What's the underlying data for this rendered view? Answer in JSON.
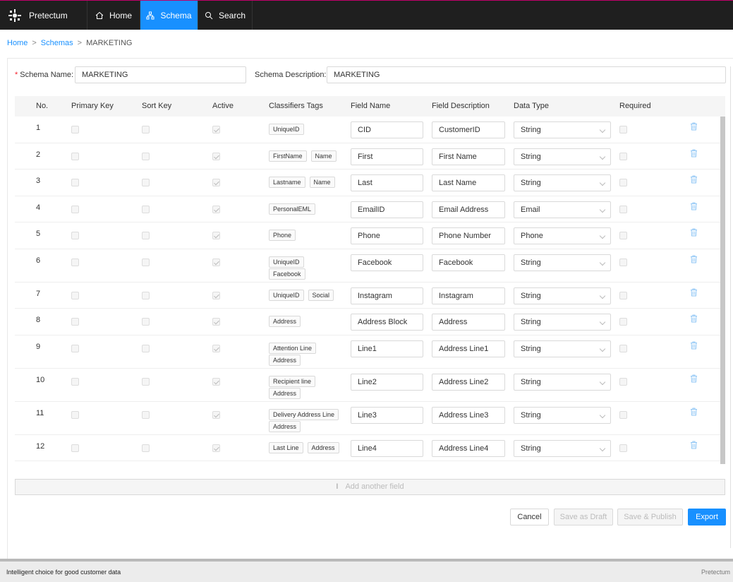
{
  "app": {
    "name": "Pretectum"
  },
  "nav": [
    {
      "label": "Home",
      "icon": "home-icon",
      "active": false
    },
    {
      "label": "Schema",
      "icon": "schema-icon",
      "active": true
    },
    {
      "label": "Search",
      "icon": "search-icon",
      "active": false
    }
  ],
  "breadcrumb": {
    "home": "Home",
    "schemas": "Schemas",
    "current": "MARKETING",
    "sep": ">"
  },
  "schema": {
    "name_label": "Schema Name:",
    "name_value": "MARKETING",
    "desc_label": "Schema Description:",
    "desc_value": "MARKETING"
  },
  "table": {
    "headers": [
      "No.",
      "Primary Key",
      "Sort Key",
      "Active",
      "Classifiers Tags",
      "Field Name",
      "Field Description",
      "Data Type",
      "Required"
    ],
    "rows": [
      {
        "no": "1",
        "tags": [
          [
            "UniqueID"
          ]
        ],
        "field_name": "CID",
        "field_desc": "CustomerID",
        "data_type": "String"
      },
      {
        "no": "2",
        "tags": [
          [
            "FirstName",
            "Name"
          ]
        ],
        "field_name": "First",
        "field_desc": "First Name",
        "data_type": "String"
      },
      {
        "no": "3",
        "tags": [
          [
            "Lastname",
            "Name"
          ]
        ],
        "field_name": "Last",
        "field_desc": "Last Name",
        "data_type": "String"
      },
      {
        "no": "4",
        "tags": [
          [
            "PersonalEML"
          ]
        ],
        "field_name": "EmailID",
        "field_desc": "Email Address",
        "data_type": "Email"
      },
      {
        "no": "5",
        "tags": [
          [
            "Phone"
          ]
        ],
        "field_name": "Phone",
        "field_desc": "Phone Number",
        "data_type": "Phone"
      },
      {
        "no": "6",
        "tags": [
          [
            "UniqueID"
          ],
          [
            "Facebook"
          ]
        ],
        "field_name": "Facebook",
        "field_desc": "Facebook",
        "data_type": "String"
      },
      {
        "no": "7",
        "tags": [
          [
            "UniqueID",
            "Social"
          ]
        ],
        "field_name": "Instagram",
        "field_desc": "Instagram",
        "data_type": "String"
      },
      {
        "no": "8",
        "tags": [
          [
            "Address"
          ]
        ],
        "field_name": "Address Block",
        "field_desc": "Address",
        "data_type": "String"
      },
      {
        "no": "9",
        "tags": [
          [
            "Attention Line"
          ],
          [
            "Address"
          ]
        ],
        "field_name": "Line1",
        "field_desc": "Address Line1",
        "data_type": "String"
      },
      {
        "no": "10",
        "tags": [
          [
            "Recipient line"
          ],
          [
            "Address"
          ]
        ],
        "field_name": "Line2",
        "field_desc": "Address Line2",
        "data_type": "String"
      },
      {
        "no": "11",
        "tags": [
          [
            "Delivery Address Line"
          ],
          [
            "Address"
          ]
        ],
        "field_name": "Line3",
        "field_desc": "Address Line3",
        "data_type": "String"
      },
      {
        "no": "12",
        "tags": [
          [
            "Last Line",
            "Address"
          ]
        ],
        "field_name": "Line4",
        "field_desc": "Address Line4",
        "data_type": "String"
      }
    ]
  },
  "add_field": {
    "label": "Add another field",
    "cursor": "I"
  },
  "buttons": {
    "cancel": "Cancel",
    "draft": "Save as Draft",
    "publish": "Save & Publish",
    "export": "Export"
  },
  "footer": {
    "tagline": "Intelligent choice for good customer data",
    "brand": "Pretectum"
  },
  "colors": {
    "accent": "#1890ff",
    "topbar": "#1f1f1f",
    "required": "#f5222d"
  }
}
